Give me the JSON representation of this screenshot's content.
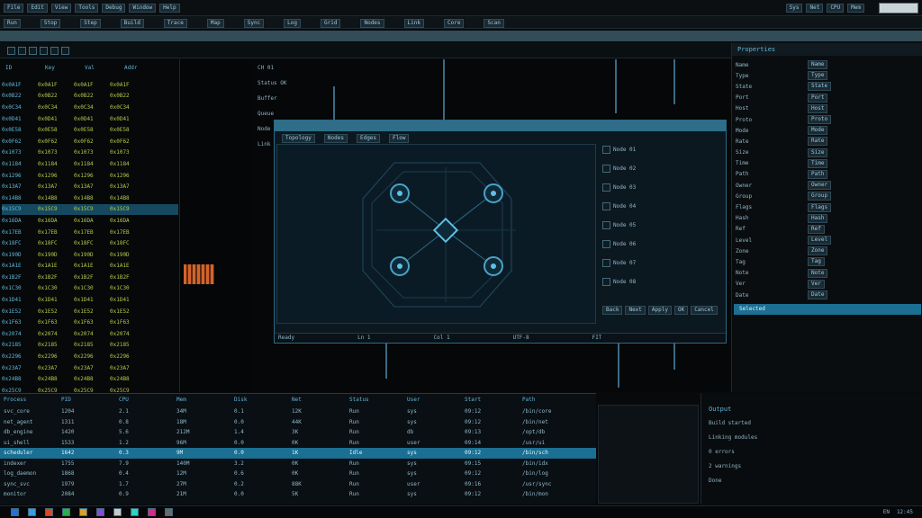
{
  "colors": {
    "bg": "#07090b",
    "accent": "#1b6f92",
    "lime": "#b5c94a",
    "orange": "#d4632a",
    "cyan": "#5fb6d8"
  },
  "menubar": {
    "items": [
      "File",
      "Edit",
      "View",
      "Tools",
      "Debug",
      "Window",
      "Help"
    ],
    "right": [
      "Sys",
      "Net",
      "CPU",
      "Mem"
    ]
  },
  "toolbar": {
    "items": [
      "Run",
      "Stop",
      "Step",
      "Build",
      "Trace",
      "Map",
      "Sync",
      "Log",
      "Grid",
      "Nodes",
      "Link",
      "Core",
      "Scan"
    ]
  },
  "left_panel": {
    "header": [
      "ID",
      "Key",
      "Val",
      "Addr"
    ],
    "rows": [
      "0x0A1F",
      "0x0B22",
      "0x0C34",
      "0x0D41",
      "0x0E58",
      "0x0F62",
      "0x1073",
      "0x1184",
      "0x1296",
      "0x13A7",
      "0x14B8",
      "0x15C9",
      "0x16DA",
      "0x17EB",
      "0x18FC",
      "0x190D",
      "0x1A1E",
      "0x1B2F",
      "0x1C30",
      "0x1D41",
      "0x1E52",
      "0x1F63",
      "0x2074",
      "0x2185",
      "0x2296",
      "0x23A7",
      "0x24B8",
      "0x25C9"
    ]
  },
  "center": {
    "labels": [
      "CH 01",
      "Status OK",
      "Buffer",
      "Queue",
      "Node A",
      "Link"
    ],
    "dialog": {
      "tabs": [
        "Topology",
        "Nodes",
        "Edges",
        "Flow"
      ],
      "side_items": [
        "Node 01",
        "Node 02",
        "Node 03",
        "Node 04",
        "Node 05",
        "Node 06",
        "Node 07",
        "Node 08"
      ],
      "footer_buttons": [
        "Back",
        "Next",
        "Apply",
        "OK",
        "Cancel"
      ],
      "statusbar": [
        "Ready",
        "Ln 1",
        "Col 1",
        "UTF-8",
        "FIT"
      ]
    }
  },
  "right_panel": {
    "header": "Properties",
    "rows": [
      "Name",
      "Type",
      "State",
      "Port",
      "Host",
      "Proto",
      "Mode",
      "Rate",
      "Size",
      "Time",
      "Path",
      "Owner",
      "Group",
      "Flags",
      "Hash",
      "Ref",
      "Level",
      "Zone",
      "Tag",
      "Note",
      "Ver",
      "Date"
    ],
    "selected": "Selected"
  },
  "bottom_table": {
    "columns": [
      "Process",
      "PID",
      "CPU",
      "Mem",
      "Disk",
      "Net",
      "Status",
      "User",
      "Start",
      "Path"
    ],
    "rows": [
      [
        "svc_core",
        "1204",
        "2.1",
        "34M",
        "0.1",
        "12K",
        "Run",
        "sys",
        "09:12",
        "/bin/core"
      ],
      [
        "net_agent",
        "1311",
        "0.8",
        "18M",
        "0.0",
        "44K",
        "Run",
        "sys",
        "09:12",
        "/bin/net"
      ],
      [
        "db_engine",
        "1420",
        "5.6",
        "212M",
        "1.4",
        "3K",
        "Run",
        "db",
        "09:13",
        "/opt/db"
      ],
      [
        "ui_shell",
        "1533",
        "1.2",
        "96M",
        "0.0",
        "0K",
        "Run",
        "user",
        "09:14",
        "/usr/ui"
      ],
      [
        "scheduler",
        "1642",
        "0.3",
        "9M",
        "0.0",
        "1K",
        "Idle",
        "sys",
        "09:12",
        "/bin/sch"
      ],
      [
        "indexer",
        "1755",
        "7.9",
        "140M",
        "3.2",
        "0K",
        "Run",
        "sys",
        "09:15",
        "/bin/idx"
      ],
      [
        "log_daemon",
        "1868",
        "0.4",
        "12M",
        "0.6",
        "0K",
        "Run",
        "sys",
        "09:12",
        "/bin/log"
      ],
      [
        "sync_svc",
        "1979",
        "1.7",
        "27M",
        "0.2",
        "88K",
        "Run",
        "user",
        "09:16",
        "/usr/sync"
      ],
      [
        "monitor",
        "2084",
        "0.9",
        "21M",
        "0.0",
        "5K",
        "Run",
        "sys",
        "09:12",
        "/bin/mon"
      ]
    ],
    "selected_row": 4
  },
  "bottom_right": {
    "title": "Output",
    "lines": [
      "Build started",
      "Linking modules",
      "0 errors",
      "2 warnings",
      "Done"
    ]
  },
  "taskbar": {
    "icons": [
      "start-icon",
      "files-icon",
      "browser-icon",
      "terminal-icon",
      "mail-icon",
      "settings-icon",
      "editor-icon",
      "chart-icon",
      "music-icon",
      "folder-icon"
    ],
    "tray": [
      "EN",
      "12:45"
    ]
  }
}
